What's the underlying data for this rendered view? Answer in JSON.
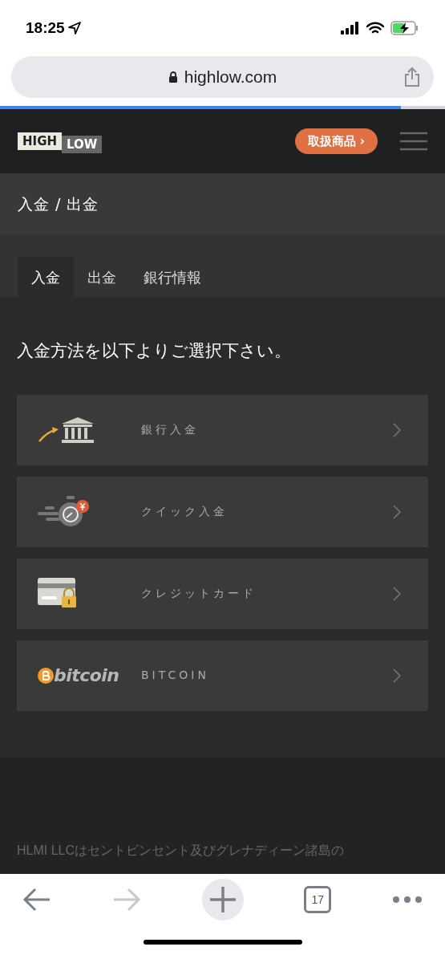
{
  "status_bar": {
    "time": "18:25"
  },
  "browser": {
    "url": "highlow.com",
    "load_progress": {
      "level": 0.9
    }
  },
  "header": {
    "logo": [
      "HIGH",
      "LOW"
    ],
    "products_button": "取扱商品 ›"
  },
  "breadcrumb": "入金 / 出金",
  "tabs": [
    {
      "label": "入金",
      "selected": true
    },
    {
      "label": "出金",
      "selected": false
    },
    {
      "label": "銀行情報",
      "selected": false
    }
  ],
  "heading": "入金方法を以下よりご選択下さい。",
  "methods": [
    {
      "kind": "bank",
      "label": "銀行入金"
    },
    {
      "kind": "quick",
      "label": "クイック入金"
    },
    {
      "kind": "card",
      "label": "クレジットカード"
    },
    {
      "kind": "bitcoin",
      "logo_text": "bitcoin",
      "label": "BITCOIN"
    }
  ],
  "footer": {
    "text": "HLMI LLCはセントビンセント及びグレナディーン諸島の"
  },
  "toolbar": {
    "tab_count": "17"
  }
}
